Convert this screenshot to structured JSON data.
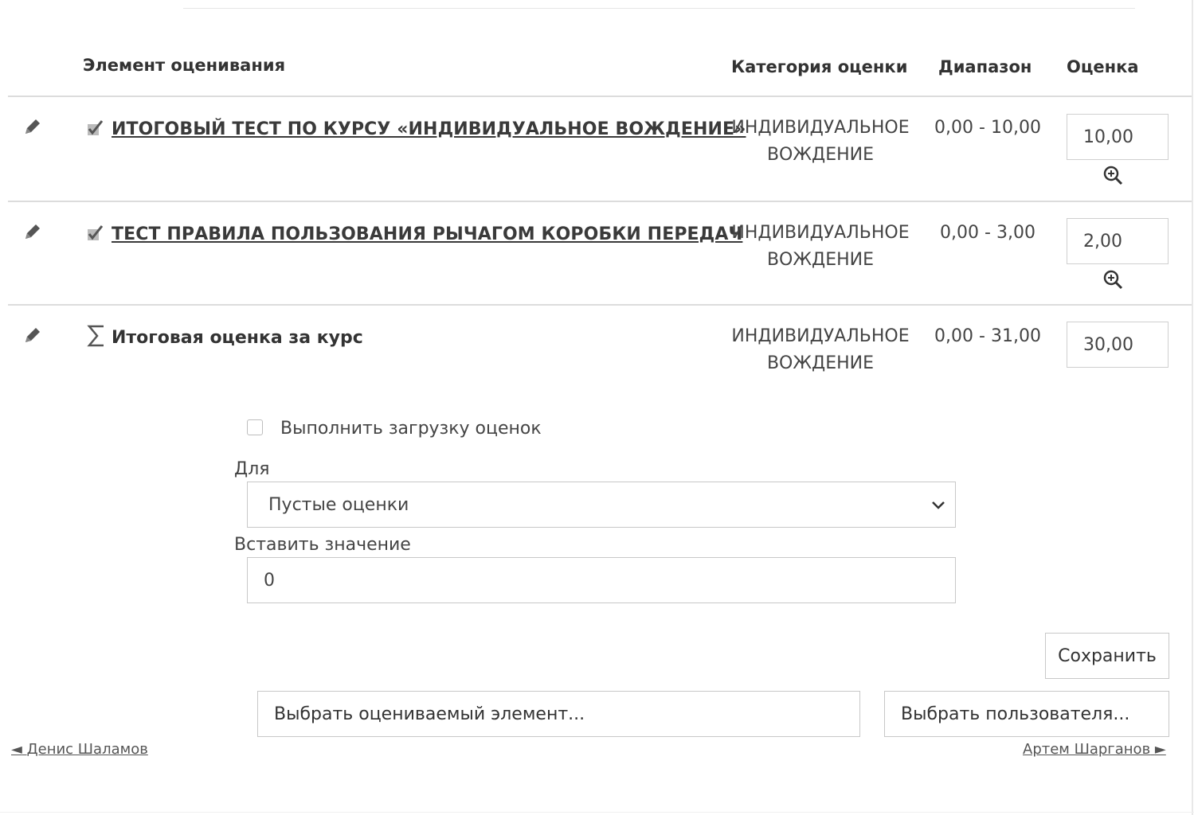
{
  "table": {
    "headers": {
      "item": "Элемент оценивания",
      "category": "Категория оценки",
      "range": "Диапазон",
      "grade": "Оценка"
    },
    "rows": [
      {
        "item": "ИТОГОВЫЙ ТЕСТ ПО КУРСУ «ИНДИВИДУАЛЬНОЕ ВОЖДЕНИЕ»",
        "category": "ИНДИВИДУАЛЬНОЕ ВОЖДЕНИЕ",
        "range": "0,00 - 10,00",
        "grade": "10,00"
      },
      {
        "item": "ТЕСТ ПРАВИЛА ПОЛЬЗОВАНИЯ РЫЧАГОМ КОРОБКИ ПЕРЕДАЧ",
        "category": "ИНДИВИДУАЛЬНОЕ ВОЖДЕНИЕ",
        "range": "0,00 - 3,00",
        "grade": "2,00"
      },
      {
        "item": "Итоговая оценка за курс",
        "category": "ИНДИВИДУАЛЬНОЕ ВОЖДЕНИЕ",
        "range": "0,00 - 31,00",
        "grade": "30,00"
      }
    ]
  },
  "bulk": {
    "checkbox_label": "Выполнить загрузку оценок",
    "checked": false,
    "for_label": "Для",
    "for_selected": "Пустые оценки",
    "insert_label": "Вставить значение",
    "insert_value": "0"
  },
  "actions": {
    "save": "Сохранить",
    "select_item": "Выбрать оцениваемый элемент...",
    "select_user": "Выбрать пользователя..."
  },
  "nav": {
    "prev_user": "Денис Шаламов",
    "next_user": "Артем Шарганов"
  },
  "colors": {
    "text": "#333333",
    "border": "#c8c8c8",
    "separator": "#dcdcdc"
  }
}
